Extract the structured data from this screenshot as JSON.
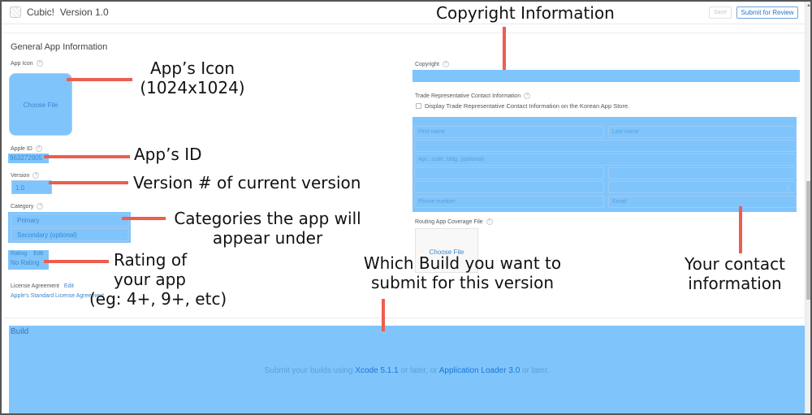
{
  "header": {
    "app_name": "Cubic!",
    "version_label": "Version 1.0",
    "save_label": "Save",
    "submit_label": "Submit for Review"
  },
  "general": {
    "section_title": "General App Information",
    "app_icon_label": "App Icon",
    "app_icon_button": "Choose File",
    "apple_id_label": "Apple ID",
    "apple_id_value": "963272905",
    "version_label": "Version",
    "version_value": "1.0",
    "category_label": "Category",
    "category_primary": "Primary",
    "category_secondary": "Secondary (optional)",
    "rating_label": "Rating",
    "rating_edit": "Edit",
    "rating_value": "No Rating",
    "license_label": "License Agreement",
    "license_edit": "Edit",
    "license_link": "Apple's Standard License Agreement"
  },
  "right": {
    "copyright_label": "Copyright",
    "copyright_value": "",
    "trade_label": "Trade Representative Contact Information",
    "trade_checkbox": "Display Trade Representative Contact Information on the Korean App Store.",
    "trade_checked": false,
    "contact": {
      "first_name": "First name",
      "last_name": "Last name",
      "address": "",
      "apt": "Apt., suite, bldg. (optional)",
      "city": "",
      "state": "",
      "postal": "",
      "country": "",
      "phone": "Phone number",
      "email": "Email"
    },
    "routing_label": "Routing App Coverage File",
    "routing_button": "Choose File"
  },
  "build": {
    "title": "Build",
    "msg_prefix": "Submit your builds using ",
    "xcode_link": "Xcode 5.1.1",
    "msg_mid": " or later, or ",
    "loader_link": "Application Loader 3.0",
    "msg_suffix": " or later."
  },
  "annotations": {
    "copyright": "Copyright Information",
    "icon_line1": "App’s Icon",
    "icon_line2": "(1024x1024)",
    "app_id": "App’s ID",
    "version": "Version # of current version",
    "categories_line1": "Categories the app will",
    "categories_line2": "appear under",
    "rating_line1": "Rating of",
    "rating_line2": "your app",
    "rating_line3": "(eg: 4+, 9+, etc)",
    "build_line1": "Which Build you want to",
    "build_line2": "submit for this version",
    "contact_line1": "Your contact",
    "contact_line2": "information"
  },
  "colors": {
    "highlight": "#80c4fc",
    "annotation_line": "#ec5e4e",
    "link": "#3a86cc"
  }
}
